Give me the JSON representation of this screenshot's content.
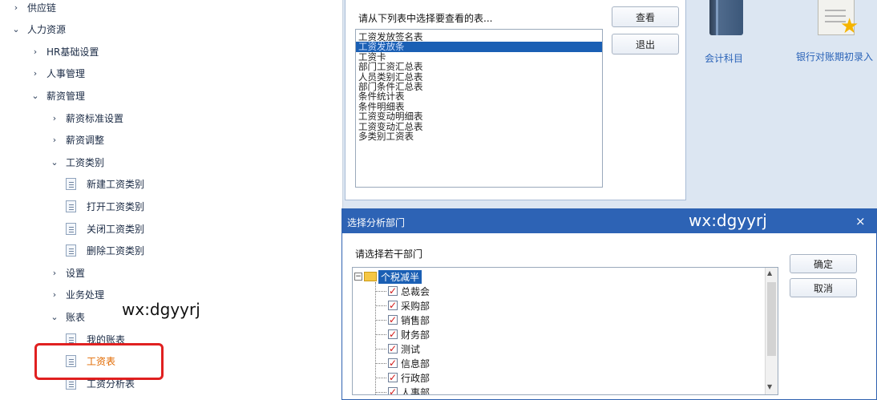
{
  "tree": {
    "items": [
      {
        "label": "供应链",
        "arrow": "›",
        "level": 0
      },
      {
        "label": "人力资源",
        "arrow": "⌄",
        "level": 0
      },
      {
        "label": "HR基础设置",
        "arrow": "›",
        "level": 1
      },
      {
        "label": "人事管理",
        "arrow": "›",
        "level": 1
      },
      {
        "label": "薪资管理",
        "arrow": "⌄",
        "level": 1
      },
      {
        "label": "薪资标准设置",
        "arrow": "›",
        "level": 2
      },
      {
        "label": "薪资调整",
        "arrow": "›",
        "level": 2
      },
      {
        "label": "工资类别",
        "arrow": "⌄",
        "level": 2
      },
      {
        "label": "新建工资类别",
        "arrow": "doc",
        "level": 3
      },
      {
        "label": "打开工资类别",
        "arrow": "doc",
        "level": 3
      },
      {
        "label": "关闭工资类别",
        "arrow": "doc",
        "level": 3
      },
      {
        "label": "删除工资类别",
        "arrow": "doc",
        "level": 3
      },
      {
        "label": "设置",
        "arrow": "›",
        "level": 2
      },
      {
        "label": "业务处理",
        "arrow": "›",
        "level": 2
      },
      {
        "label": "账表",
        "arrow": "⌄",
        "level": 2
      },
      {
        "label": "我的账表",
        "arrow": "doc",
        "level": 3
      },
      {
        "label": "工资表",
        "arrow": "doc",
        "level": 3,
        "active": true
      },
      {
        "label": "工资分析表",
        "arrow": "doc",
        "level": 3
      }
    ],
    "watermark": "wx:dgyyrj"
  },
  "report_dialog": {
    "prompt": "请从下列表中选择要查看的表...",
    "list": [
      "工资发放签名表",
      "工资发放条",
      "工资卡",
      "部门工资汇总表",
      "人员类别汇总表",
      "部门条件汇总表",
      "条件统计表",
      "条件明细表",
      "工资变动明细表",
      "工资变动汇总表",
      "多类别工资表"
    ],
    "selected_index": 1,
    "view_label": "查看",
    "exit_label": "退出"
  },
  "desktop": {
    "accounts_label": "会计科目",
    "bank_label": "银行对账期初录入"
  },
  "dept_dialog": {
    "title": "选择分析部门",
    "watermark": "wx:dgyyrj",
    "close": "×",
    "prompt": "请选择若干部门",
    "root_expander": "−",
    "root_label": "个税减半",
    "departments": [
      "总裁会",
      "采购部",
      "销售部",
      "财务部",
      "测试",
      "信息部",
      "行政部",
      "人事部"
    ],
    "ok_label": "确定",
    "cancel_label": "取消"
  },
  "colors": {
    "titlebar": "#2d63b5",
    "selection": "#1a5fb4",
    "active_item": "#e26a00",
    "highlight_box": "#e02020",
    "link": "#2a63b8"
  }
}
